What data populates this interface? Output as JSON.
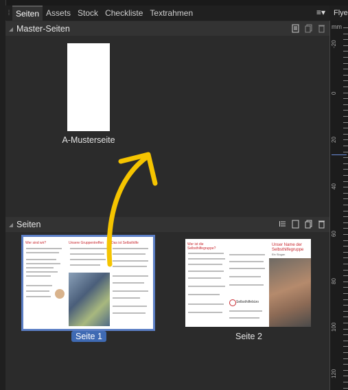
{
  "tabs": [
    "Seiten",
    "Assets",
    "Stock",
    "Checkliste",
    "Textrahmen"
  ],
  "side_tab": "Flye",
  "master_panel": {
    "title": "Master-Seiten",
    "page_label": "A-Musterseite"
  },
  "pages_panel": {
    "title": "Seiten",
    "page1_label": "Seite 1",
    "page2_label": "Seite 2"
  },
  "ruler": {
    "unit": "mm",
    "labels": [
      "-20",
      "0",
      "20",
      "40",
      "60",
      "80",
      "100",
      "120"
    ]
  },
  "thumb1": {
    "h1": "Wer sind wir?",
    "h2": "Unsere Gruppentreffen",
    "h3": "Das ist Selbsthilfe"
  },
  "thumb2": {
    "h1": "Wer ist die Selbsthilfegruppe?",
    "h2": "Unser Name der Selbsthilfegruppe",
    "h3": "Ein Slogan",
    "brand": "Selbsthilfebüro"
  },
  "accent_colors": {
    "selection": "#5b7ec5",
    "arrow": "#f5c400",
    "red": "#c8262d"
  }
}
